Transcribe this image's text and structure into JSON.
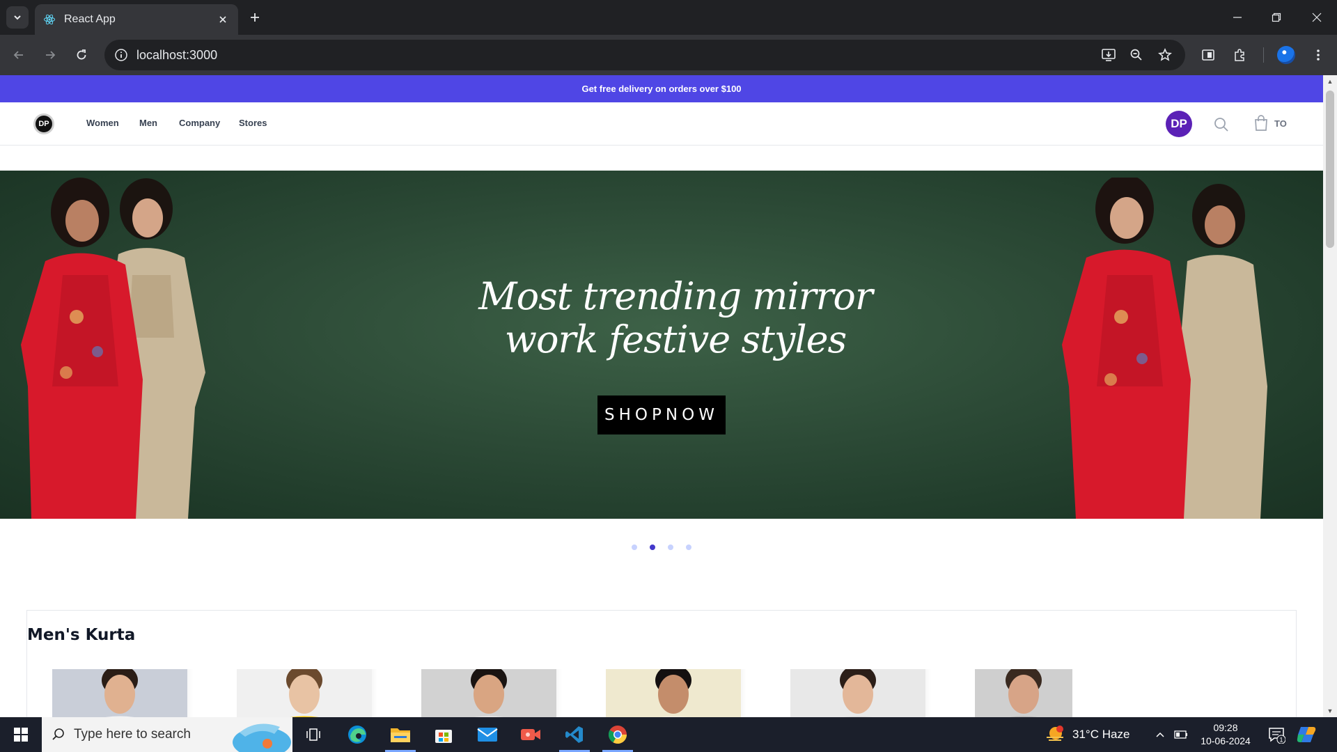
{
  "browser": {
    "tab_title": "React App",
    "url": "localhost:3000"
  },
  "site": {
    "promo": "Get free delivery on orders over $100",
    "logo_text": "DP",
    "nav": [
      "Women",
      "Men",
      "Company",
      "Stores"
    ],
    "user_initials": "DP",
    "cart_label": "TO"
  },
  "hero": {
    "headline_line1": "Most trending mirror",
    "headline_line2": "work festive styles",
    "cta": "SHOPNOW",
    "slide_count": 4,
    "active_slide": 2
  },
  "products": {
    "section_title": "Men's Kurta",
    "card_backgrounds": [
      "#c9ced8",
      "#f0f0f0",
      "#d2d2d2",
      "#efe9cf",
      "#e8e8e8",
      "#cfcfcf"
    ],
    "kurta_colors": [
      "#f2f3f5",
      "#f5c400",
      "#e9e9ea",
      "#f3eee0",
      "#dcdcdc",
      "#b8b8b8"
    ]
  },
  "taskbar": {
    "search_placeholder": "Type here to search",
    "weather": "31°C  Haze",
    "time": "09:28",
    "date": "10-06-2024",
    "notification_count": "1"
  },
  "colors": {
    "promo_bg": "#4f46e5",
    "avatar_bg": "#5b21b6",
    "hero_bg": "#2c4a36",
    "dot_active": "#4338ca"
  }
}
